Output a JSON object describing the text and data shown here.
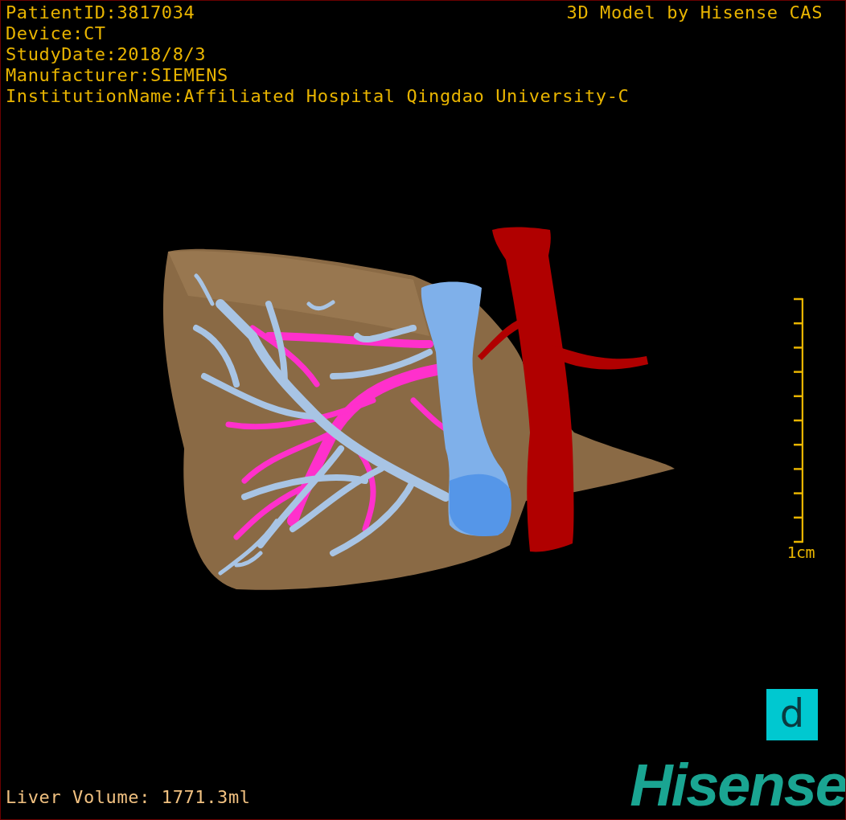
{
  "info_lines": [
    "PatientID:3817034",
    "Device:CT",
    "StudyDate:2018/8/3",
    "Manufacturer:SIEMENS",
    "InstitutionName:Affiliated Hospital Qingdao University-C"
  ],
  "title": "3D Model by Hisense CAS",
  "scale_bar": {
    "label": "1cm"
  },
  "liver_volume": "Liver Volume: 1771.3ml",
  "badge": "d",
  "logo": "Hisense"
}
